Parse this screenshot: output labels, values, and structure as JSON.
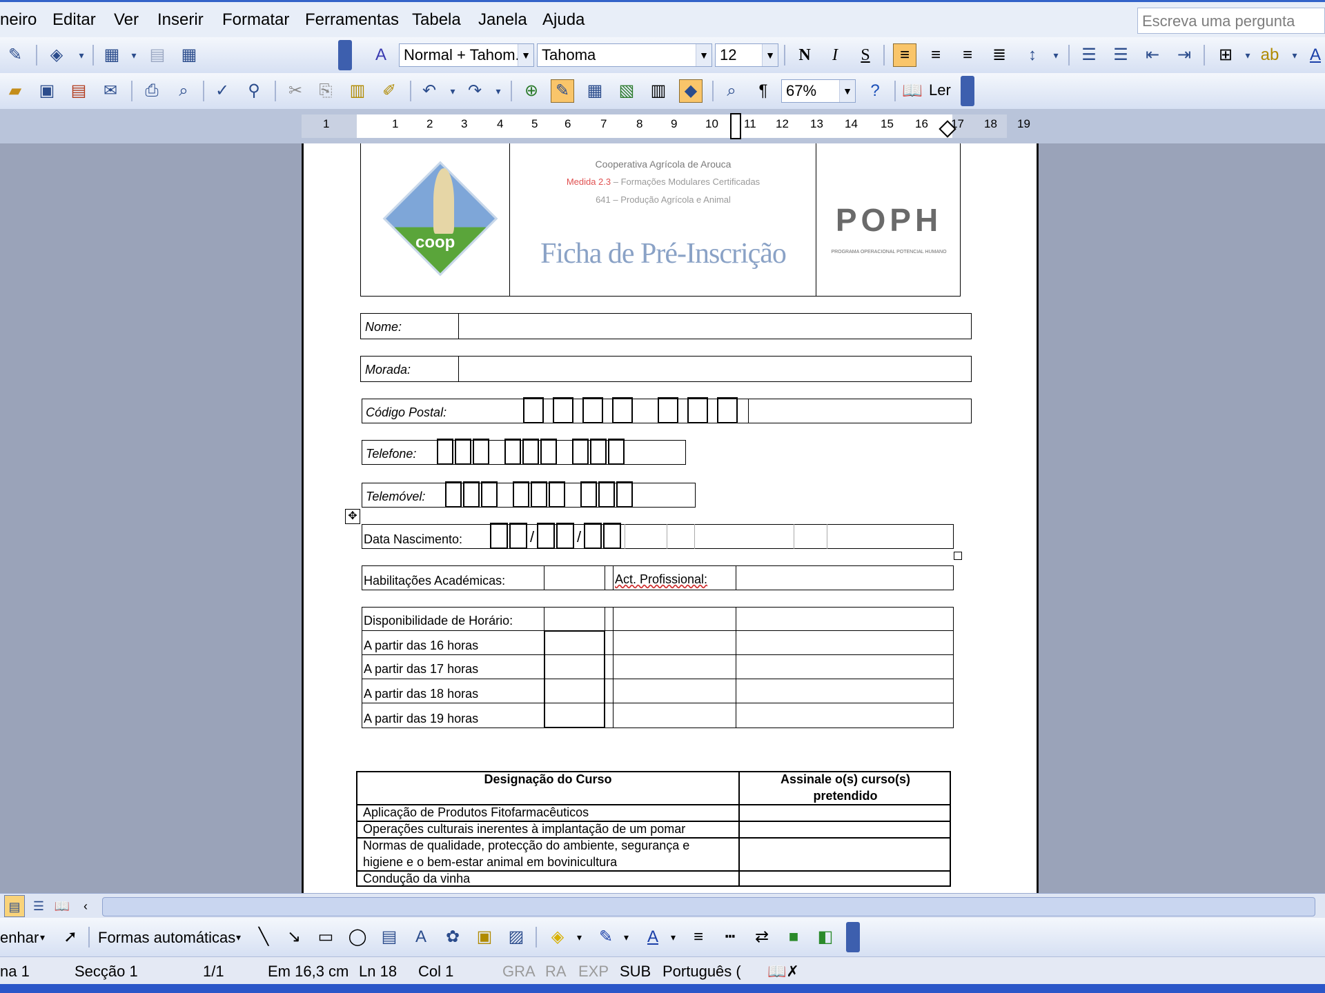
{
  "menu": {
    "items": [
      "neiro",
      "Editar",
      "Ver",
      "Inserir",
      "Formatar",
      "Ferramentas",
      "Tabela",
      "Janela",
      "Ajuda"
    ],
    "ask_placeholder": "Escreva uma pergunta"
  },
  "format_toolbar": {
    "style": "Normal + Tahom.",
    "font": "Tahoma",
    "size": "12",
    "bold_label": "N",
    "italic_label": "I",
    "underline_label": "S"
  },
  "standard_toolbar": {
    "zoom": "67%",
    "read_label": "Ler"
  },
  "ruler": {
    "labels": [
      "1",
      "1",
      "2",
      "3",
      "4",
      "5",
      "6",
      "7",
      "8",
      "9",
      "10",
      "11",
      "12",
      "13",
      "14",
      "15",
      "16",
      "17",
      "18",
      "19"
    ]
  },
  "document": {
    "header": {
      "org_line": "Cooperativa Agrícola de Arouca",
      "measure_highlight": "Medida 2.3",
      "measure_rest": "– Formações Modulares Certificadas",
      "code_line": "641 – Produção Agrícola e Animal",
      "form_title": "Ficha de Pré-Inscrição",
      "logo_left_text": "coop",
      "logo_right_text": "POPH",
      "logo_right_sub": "PROGRAMA OPERACIONAL POTENCIAL HUMANO"
    },
    "fields": {
      "nome": "Nome:",
      "morada": "Morada:",
      "codigo_postal": "Código Postal:",
      "telefone": "Telefone:",
      "telemovel": "Telemóvel:",
      "data_nascimento": "Data Nascimento:",
      "slash": "/",
      "habilitacoes": "Habilitações Académicas:",
      "act_profissional": "Act. Profissional:"
    },
    "horario": {
      "title": "Disponibilidade de Horário:",
      "options": [
        "A partir das 16 horas",
        "A partir das 17 horas",
        "A partir das 18 horas",
        "A partir das 19 horas"
      ]
    },
    "cursos": {
      "col1": "Designação do Curso",
      "col2_line1": "Assinale o(s) curso(s)",
      "col2_line2": "pretendido",
      "rows": [
        "Aplicação de Produtos Fitofarmacêuticos",
        "Operações culturais inerentes à implantação de um pomar",
        "Normas de qualidade, protecção do ambiente, segurança e",
        "higiene e o bem-estar animal em bovinicultura",
        "Condução da vinha"
      ]
    }
  },
  "draw_toolbar": {
    "draw_label": "enhar",
    "autoshapes_label": "Formas automáticas"
  },
  "status": {
    "page": "na 1",
    "section": "Secção 1",
    "pages": "1/1",
    "position": "Em 16,3 cm",
    "line": "Ln 18",
    "col": "Col 1",
    "gra": "GRA",
    "ra": "RA",
    "exp": "EXP",
    "sub": "SUB",
    "language": "Português ("
  }
}
